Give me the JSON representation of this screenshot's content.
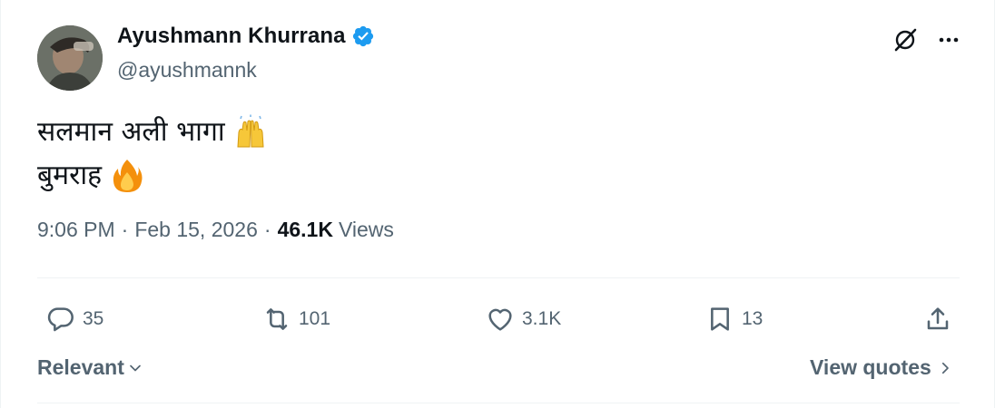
{
  "author": {
    "display_name": "Ayushmann Khurrana",
    "handle": "@ayushmannk",
    "verified": true,
    "avatar_icon": "profile-photo"
  },
  "header_icons": [
    "grok-icon",
    "more-icon"
  ],
  "tweet": {
    "lines": [
      {
        "text": "सलमान अली भागा",
        "emoji": "raising-hands-emoji"
      },
      {
        "text": "बुमराह",
        "emoji": "fire-emoji"
      }
    ]
  },
  "meta": {
    "time": "9:06 PM",
    "separator": "·",
    "date": "Feb 15, 2026",
    "views_count": "46.1K",
    "views_label": "Views"
  },
  "actions": {
    "replies": "35",
    "reposts": "101",
    "likes": "3.1K",
    "bookmarks": "13"
  },
  "footer": {
    "sort_label": "Relevant",
    "view_quotes_label": "View quotes"
  },
  "colors": {
    "text": "#0f1419",
    "secondary": "#536471",
    "verified": "#1d9bf0",
    "divider": "#eff3f4"
  }
}
